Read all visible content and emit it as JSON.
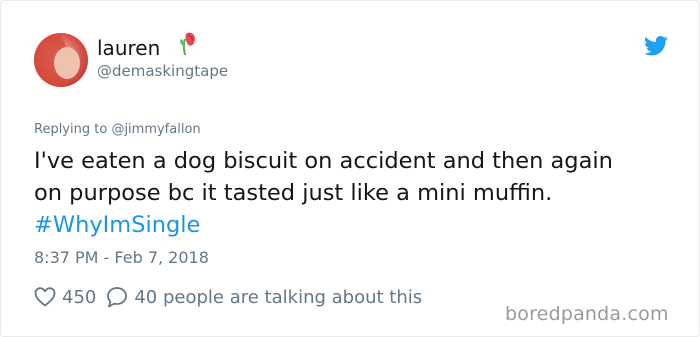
{
  "user": {
    "display_name": "lauren",
    "handle": "@demaskingtape",
    "emoji_icon": "rose-flower-icon"
  },
  "reply": {
    "prefix": "Replying to",
    "target": "@jimmyfallon"
  },
  "tweet": {
    "line1": "I've eaten a dog biscuit on accident and then again",
    "line2": "on purpose bc it tasted just like a mini muffin.",
    "hashtag": "#WhyImSingle"
  },
  "timestamp": "8:37 PM - Feb 7, 2018",
  "stats": {
    "likes": "450",
    "talking": "40 people are talking about this"
  },
  "watermark": "boredpanda.com",
  "colors": {
    "twitter_blue": "#1da1f2",
    "hashtag": "#1b95e0",
    "secondary_text": "#657786"
  }
}
